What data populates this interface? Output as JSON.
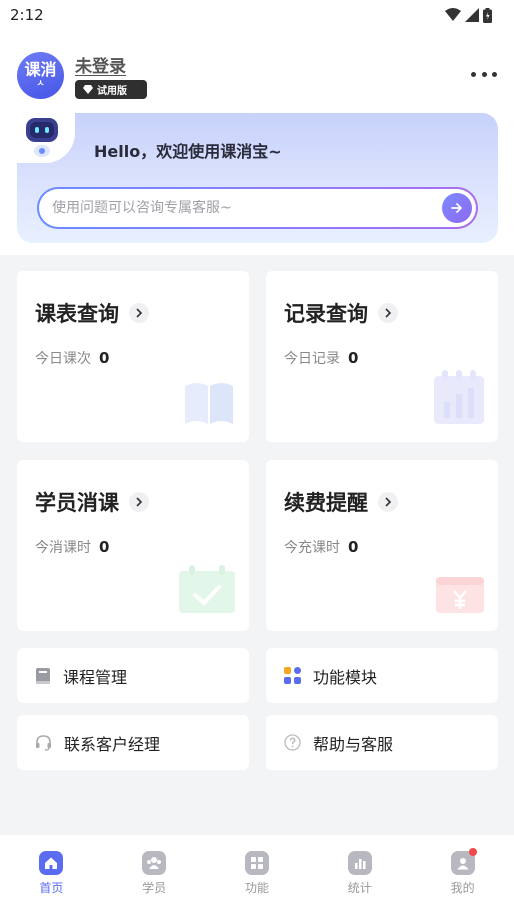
{
  "status_bar": {
    "time": "2:12"
  },
  "profile": {
    "avatar_text": "课消",
    "avatar_sub": "ㅅ",
    "username": "未登录",
    "badge": "试用版"
  },
  "banner": {
    "greeting": "Hello，欢迎使用课消宝~",
    "search_placeholder": "使用问题可以咨询专属客服~"
  },
  "cards": [
    {
      "title": "课表查询",
      "stat_label": "今日课次",
      "stat_value": "0",
      "deco": "book-icon"
    },
    {
      "title": "记录查询",
      "stat_label": "今日记录",
      "stat_value": "0",
      "deco": "record-chart-icon"
    },
    {
      "title": "学员消课",
      "stat_label": "今消课时",
      "stat_value": "0",
      "deco": "calendar-check-icon"
    },
    {
      "title": "续费提醒",
      "stat_label": "今充课时",
      "stat_value": "0",
      "deco": "yuan-icon"
    }
  ],
  "links": [
    {
      "label": "课程管理",
      "icon": "course-book-icon"
    },
    {
      "label": "功能模块",
      "icon": "modules-grid-icon"
    },
    {
      "label": "联系客户经理",
      "icon": "headset-icon"
    },
    {
      "label": "帮助与客服",
      "icon": "help-icon"
    }
  ],
  "tabs": [
    {
      "label": "首页",
      "icon": "home-icon",
      "active": true
    },
    {
      "label": "学员",
      "icon": "students-icon"
    },
    {
      "label": "功能",
      "icon": "function-grid-icon"
    },
    {
      "label": "统计",
      "icon": "stats-icon"
    },
    {
      "label": "我的",
      "icon": "profile-icon",
      "has_dot": true
    }
  ],
  "colors": {
    "accent": "#5b6cf0",
    "banner_from": "#c7d2fb",
    "badge_bg": "#2f2f2f",
    "notification_dot": "#f04848"
  }
}
